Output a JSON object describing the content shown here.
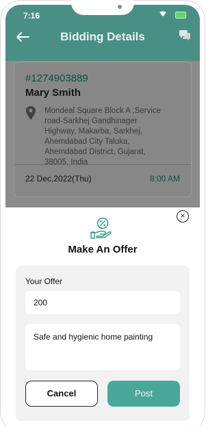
{
  "status_bar": {
    "time": "7:16"
  },
  "header": {
    "title": "Bidding Details"
  },
  "booking": {
    "id": "#1274903889",
    "customer_name": "Mary Smith",
    "address": "Mondeal Square Block A ,Service road-Sarkhej Gandhinager Highway, Makarba, Sarkhej, Ahemdabad City Taluka, Ahemdabad District, Gujarat, 38005, India",
    "date": "22 Dec,2022(Thu)",
    "time": "8:00 AM"
  },
  "offer_sheet": {
    "title": "Make An Offer",
    "offer_label": "Your Offer",
    "offer_value": "200",
    "description_value": "Safe and hygienic home painting",
    "cancel_label": "Cancel",
    "post_label": "Post"
  },
  "colors": {
    "accent": "#4a8f85",
    "post_button": "#4aa89b"
  },
  "icons": [
    "back-arrow-icon",
    "chat-icon",
    "location-pin-icon",
    "offer-percent-icon",
    "close-icon"
  ]
}
